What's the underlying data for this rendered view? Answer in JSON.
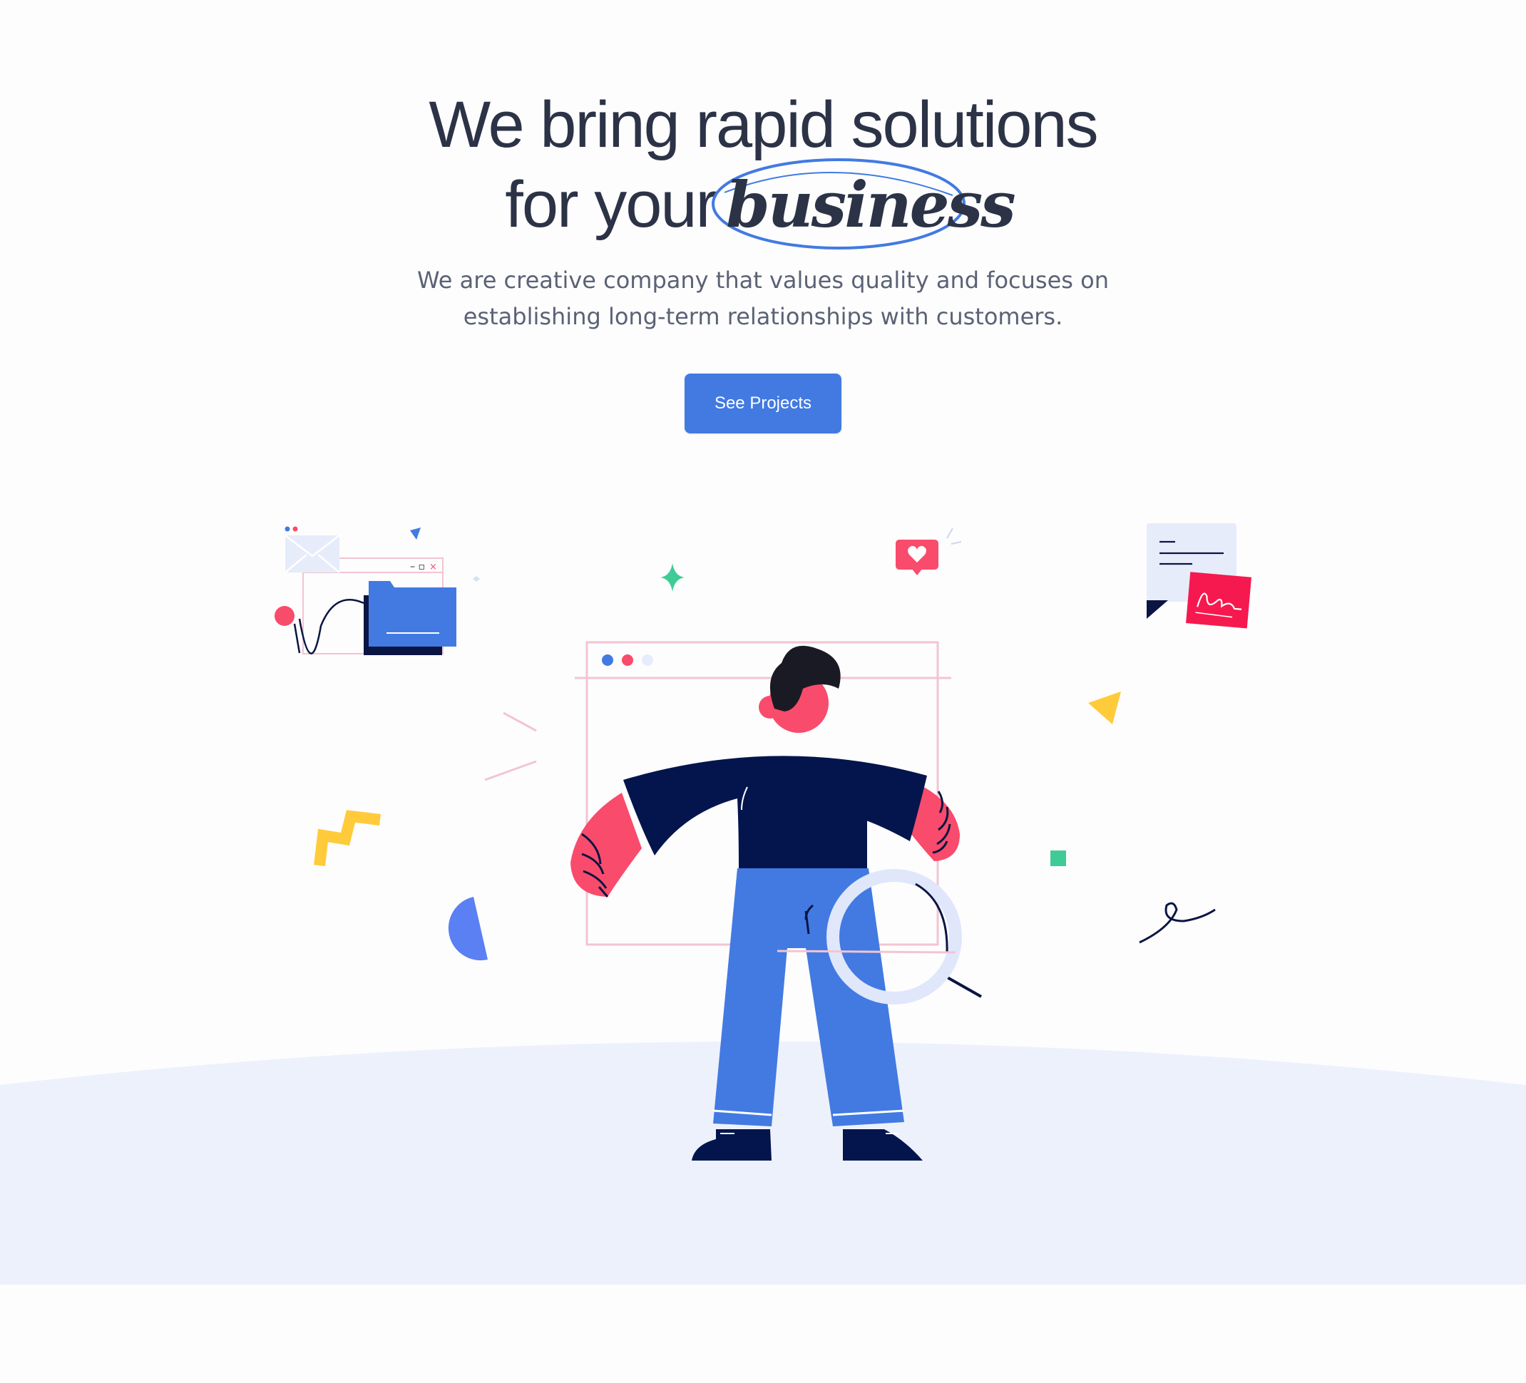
{
  "hero": {
    "headline_line1": "We bring rapid solutions",
    "headline_line2_prefix": "for your",
    "headline_emphasis": "business",
    "subtitle_line1": "We are creative company that values quality and focuses on",
    "subtitle_line2": "establishing long-term relationships with customers.",
    "cta_label": "See Projects"
  },
  "colors": {
    "heading": "#2c3346",
    "body_text": "#5b6275",
    "accent_blue": "#427ae2",
    "ground": "#edf1fb",
    "navy": "#04154d",
    "coral": "#f94b6b",
    "yellow": "#ffcb3a",
    "green": "#3fcb96"
  },
  "icons": [
    "mail-window-icon",
    "folder-icon",
    "heart-like-icon",
    "document-chat-icon",
    "signature-note-icon",
    "magnifier-icon",
    "browser-window-icon"
  ]
}
